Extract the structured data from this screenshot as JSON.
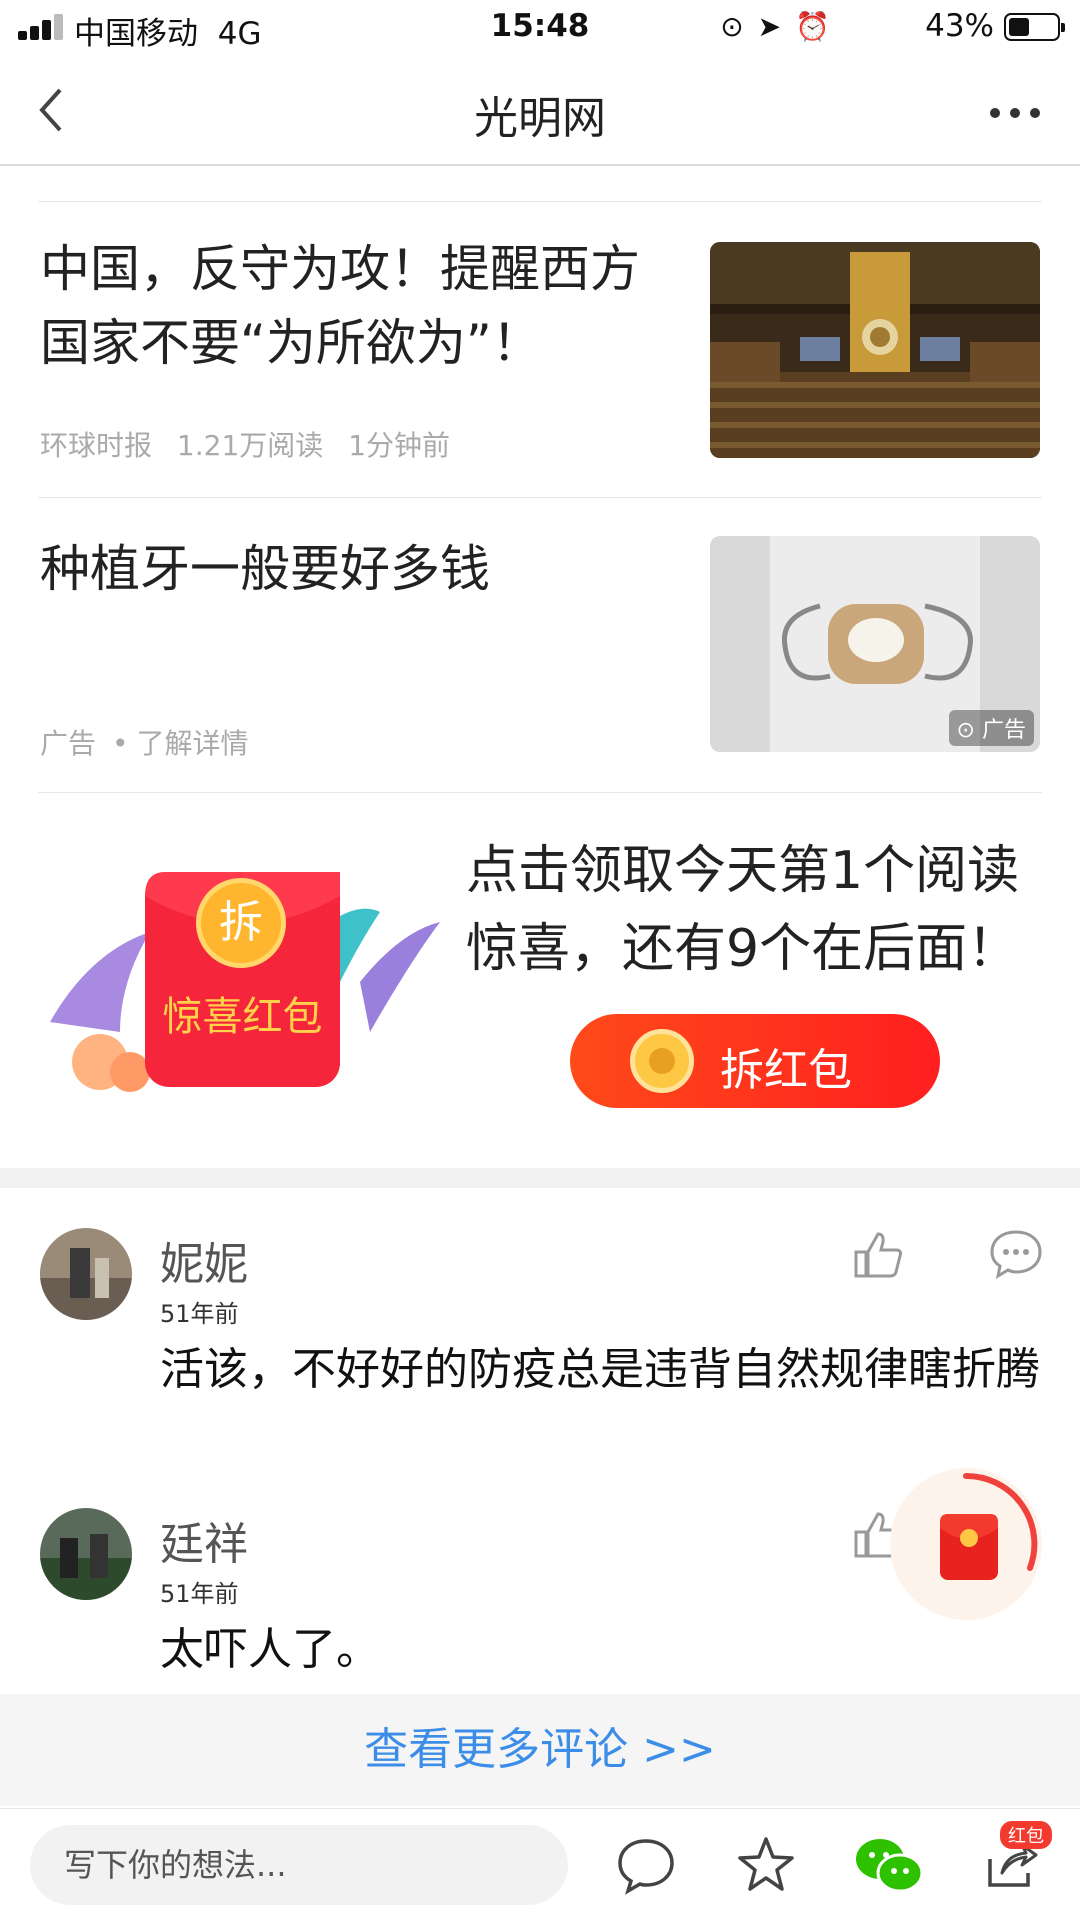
{
  "status": {
    "carrier": "中国移动",
    "network": "4G",
    "time": "15:48",
    "battery": "43%"
  },
  "nav": {
    "title": "光明网"
  },
  "articles": [
    {
      "title": "中国，反守为攻！提醒西方国家不要“为所欲为”！",
      "source": "环球时报",
      "reads": "1.21万阅读",
      "time": "1分钟前"
    },
    {
      "title": "种植牙一般要好多钱",
      "ad_label": "广告",
      "dot": "•",
      "detail": "了解详情",
      "thumb_badge": "广告"
    }
  ],
  "promo": {
    "packet_char": "拆",
    "packet_label": "惊喜红包",
    "text": "点击领取今天第1个阅读惊喜，还有9个在后面！",
    "button_label": "拆红包"
  },
  "comments": [
    {
      "name": "妮妮",
      "time": "51年前",
      "text": "活该，不好好的防疫总是违背自然规律瞎折腾"
    },
    {
      "name": "廷祥",
      "time": "51年前",
      "text": "太吓人了。"
    }
  ],
  "more_comments": "查看更多评论 >>",
  "bottom_bar": {
    "placeholder": "写下你的想法...",
    "share_badge": "红包"
  },
  "colors": {
    "accent_red": "#f23a2f",
    "link_blue": "#3b8de8",
    "wechat_green": "#2dc100"
  },
  "icons": [
    "back-icon",
    "more-icon",
    "like-icon",
    "reply-icon",
    "comment-icon",
    "star-icon",
    "wechat-icon",
    "share-icon",
    "red-packet-icon"
  ]
}
